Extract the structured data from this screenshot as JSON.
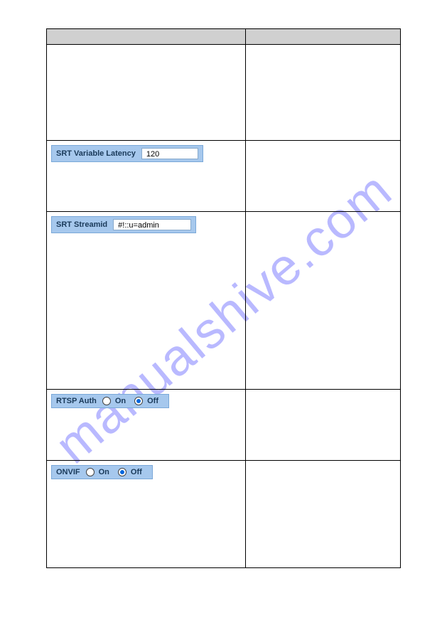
{
  "watermark": "manualshive.com",
  "rows": {
    "latency": {
      "label": "SRT Variable Latency",
      "value": "120"
    },
    "streamid": {
      "label": "SRT Streamid",
      "value": "#!::u=admin"
    },
    "rtsp": {
      "label": "RTSP Auth",
      "on": "On",
      "off": "Off"
    },
    "onvif": {
      "label": "ONVIF",
      "on": "On",
      "off": "Off"
    }
  }
}
